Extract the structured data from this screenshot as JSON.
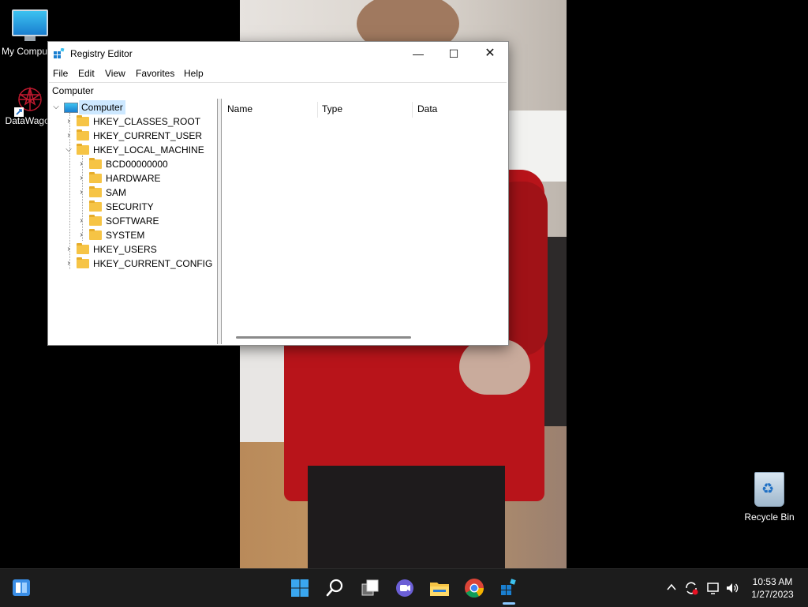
{
  "desktop": {
    "icons": [
      {
        "label": "My Computer"
      },
      {
        "label": "DataWagon"
      },
      {
        "label": "Recycle Bin"
      }
    ]
  },
  "window": {
    "title": "Registry Editor",
    "controls": {
      "minimize": "—",
      "maximize": "☐",
      "close": "✕"
    },
    "menu": [
      "File",
      "Edit",
      "View",
      "Favorites",
      "Help"
    ],
    "address": "Computer",
    "tree": [
      {
        "label": "Computer",
        "expanded": true,
        "selected": true
      },
      {
        "label": "HKEY_CLASSES_ROOT",
        "expanded": false
      },
      {
        "label": "HKEY_CURRENT_USER",
        "expanded": false
      },
      {
        "label": "HKEY_LOCAL_MACHINE",
        "expanded": true
      },
      {
        "label": "BCD00000000",
        "expanded": false
      },
      {
        "label": "HARDWARE",
        "expanded": false
      },
      {
        "label": "SAM",
        "expanded": false
      },
      {
        "label": "SECURITY",
        "expanded": false
      },
      {
        "label": "SOFTWARE",
        "expanded": false
      },
      {
        "label": "SYSTEM",
        "expanded": false
      },
      {
        "label": "HKEY_USERS",
        "expanded": false
      },
      {
        "label": "HKEY_CURRENT_CONFIG",
        "expanded": false
      }
    ],
    "columns": [
      "Name",
      "Type",
      "Data"
    ]
  },
  "taskbar": {
    "apps": [
      "start-icon",
      "search-icon",
      "task-view-icon",
      "teams-chat-icon",
      "file-explorer-icon",
      "chrome-icon",
      "registry-editor-icon"
    ],
    "tray": {
      "chevron": "^",
      "volume": "🔊"
    },
    "clock": {
      "time": "10:53 AM",
      "date": "1/27/2023"
    }
  },
  "colors": {
    "accent": "#0078d4",
    "selection": "#cde8ff",
    "taskbar": "#1c1c1c",
    "folder": "#f6c445"
  }
}
